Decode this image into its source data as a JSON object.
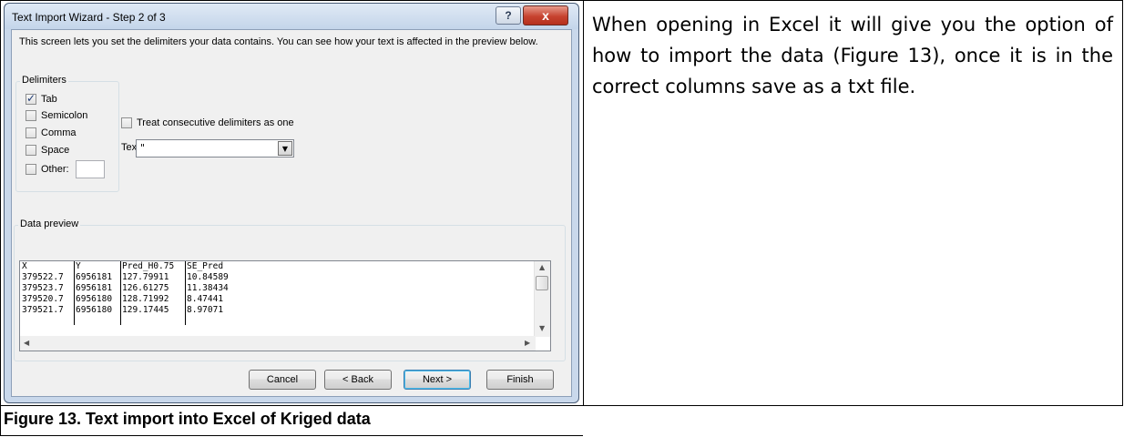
{
  "dialog": {
    "title": "Text Import Wizard - Step 2 of 3",
    "help_glyph": "?",
    "close_glyph": "x",
    "intro_text": "This screen lets you set the delimiters your data contains.  You can see how your text is affected in the preview below.",
    "delimiters": {
      "group_label": "Delimiters",
      "options": [
        {
          "label": "Tab",
          "checked": true
        },
        {
          "label": "Semicolon",
          "checked": false
        },
        {
          "label": "Comma",
          "checked": false
        },
        {
          "label": "Space",
          "checked": false
        },
        {
          "label": "Other:",
          "checked": false
        }
      ]
    },
    "treat_consecutive_label": "Treat consecutive delimiters as one",
    "text_qualifier": {
      "label": "Text qualifier:",
      "value": "\""
    },
    "preview": {
      "group_label": "Data preview",
      "columns": [
        [
          "X",
          "379522.7",
          "379523.7",
          "379520.7",
          "379521.7"
        ],
        [
          "Y",
          "6956181",
          "6956181",
          "6956180",
          "6956180"
        ],
        [
          "Pred_H0.75",
          "127.79911",
          "126.61275",
          "128.71992",
          "129.17445"
        ],
        [
          "SE_Pred",
          "10.84589",
          "11.38434",
          "8.47441",
          "8.97071"
        ]
      ]
    },
    "buttons": {
      "cancel": "Cancel",
      "back": "< Back",
      "next": "Next >",
      "finish": "Finish"
    }
  },
  "paragraph": "When opening in Excel it will give you the option of how to import the data (Figure 13), once it is in the correct columns save as a txt file.",
  "caption": "Figure 13. Text import into Excel of Kriged data"
}
